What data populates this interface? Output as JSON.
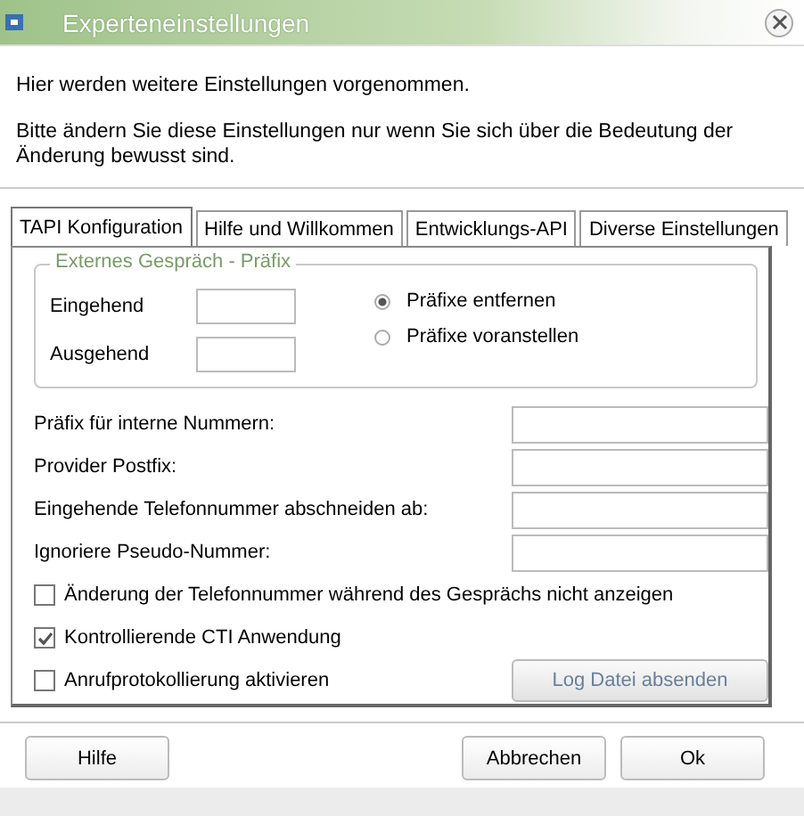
{
  "window": {
    "title": "Experteneinstellungen"
  },
  "intro": [
    "Hier werden weitere Einstellungen vorgenommen.",
    "Bitte ändern Sie diese Einstellungen nur wenn Sie sich über die Bedeutung der Änderung bewusst sind."
  ],
  "tabs": [
    {
      "label": "TAPI Konfiguration",
      "selected": true
    },
    {
      "label": "Hilfe und Willkommen",
      "selected": false
    },
    {
      "label": "Entwicklungs-API",
      "selected": false
    },
    {
      "label": "Diverse Einstellungen",
      "selected": false
    }
  ],
  "prefix_group": {
    "title": "Externes Gespräch - Präfix",
    "fields": [
      {
        "label": "Eingehend"
      },
      {
        "label": "Ausgehend"
      }
    ],
    "options": [
      {
        "label": "Präfixe entfernen",
        "selected": true
      },
      {
        "label": "Präfixe voranstellen",
        "selected": false
      }
    ]
  },
  "fields": [
    {
      "label": "Präfix für interne Nummern:"
    },
    {
      "label": "Provider Postfix:"
    },
    {
      "label": "Eingehende Telefonnummer abschneiden ab:"
    },
    {
      "label": "Ignoriere Pseudo-Nummer:"
    }
  ],
  "checkboxes": [
    {
      "label": "Änderung der Telefonnummer während des Gesprächs nicht anzeigen",
      "checked": false
    },
    {
      "label": "Kontrollierende CTI Anwendung",
      "checked": true
    },
    {
      "label": "Anrufprotokollierung aktivieren",
      "checked": false
    }
  ],
  "log_button": {
    "label": "Log Datei absenden",
    "disabled": true
  },
  "buttons": [
    "Hilfe",
    "Abbrechen",
    "Ok"
  ]
}
